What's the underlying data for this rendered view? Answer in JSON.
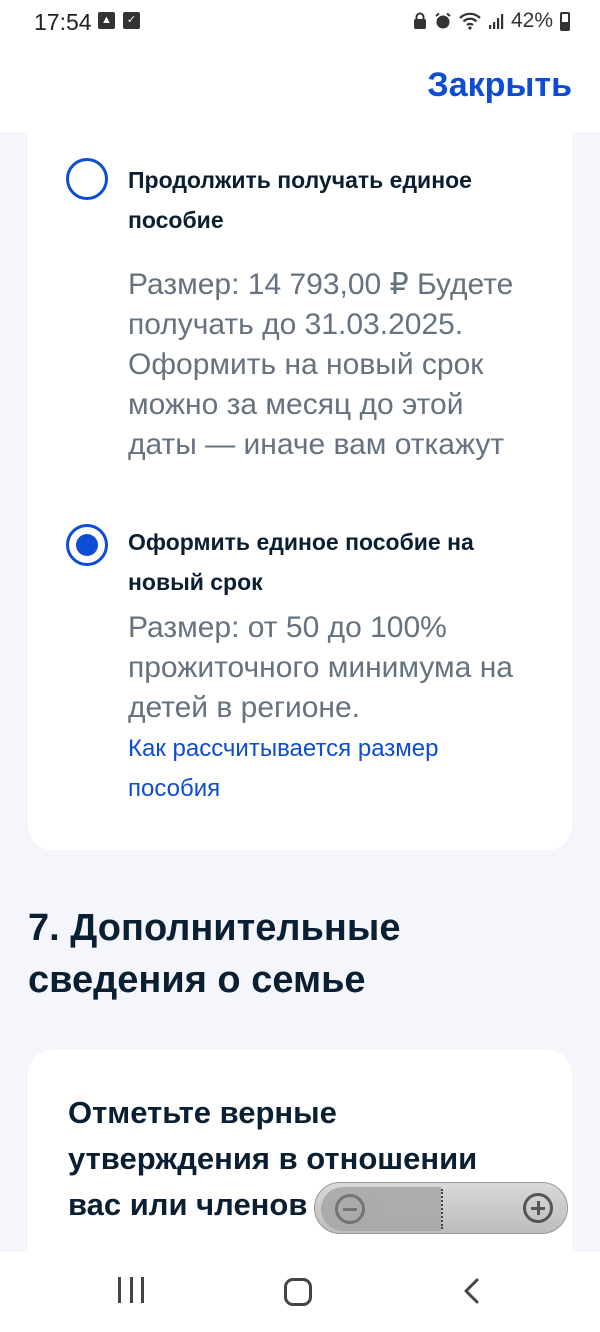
{
  "status_bar": {
    "time": "17:54",
    "left_icons": [
      "gallery-icon",
      "checkbox-icon"
    ],
    "right_icons": [
      "lock-icon",
      "alarm-icon",
      "wifi-icon",
      "signal-icon"
    ],
    "battery": "42%"
  },
  "header": {
    "close_label": "Закрыть"
  },
  "options": [
    {
      "selected": false,
      "title": "Продолжить получать единое пособие",
      "description": "Размер: 14 793,00 ₽ Будете получать до 31.03.2025. Оформить на новый срок можно за месяц до этой даты — иначе вам откажут"
    },
    {
      "selected": true,
      "title": "Оформить единое пособие на новый срок",
      "description": "Размер: от 50 до 100% прожиточного минимума на детей в регионе.",
      "link": "Как рассчитывается размер пособия"
    }
  ],
  "section": {
    "title": "7. Дополнительные сведения о семье"
  },
  "card_bottom": {
    "title": "Отметьте верные утверждения в отношении вас или членов"
  },
  "zoom": {
    "out_icon": "zoom-out-icon",
    "in_icon": "zoom-in-icon"
  },
  "nav_bar": {
    "icons": [
      "recent-apps-icon",
      "home-icon",
      "back-icon"
    ]
  },
  "colors": {
    "accent": "#0d4cd3",
    "page_background": "#f4f6fc",
    "text_primary": "#0b1f33",
    "text_secondary": "#66727f"
  }
}
